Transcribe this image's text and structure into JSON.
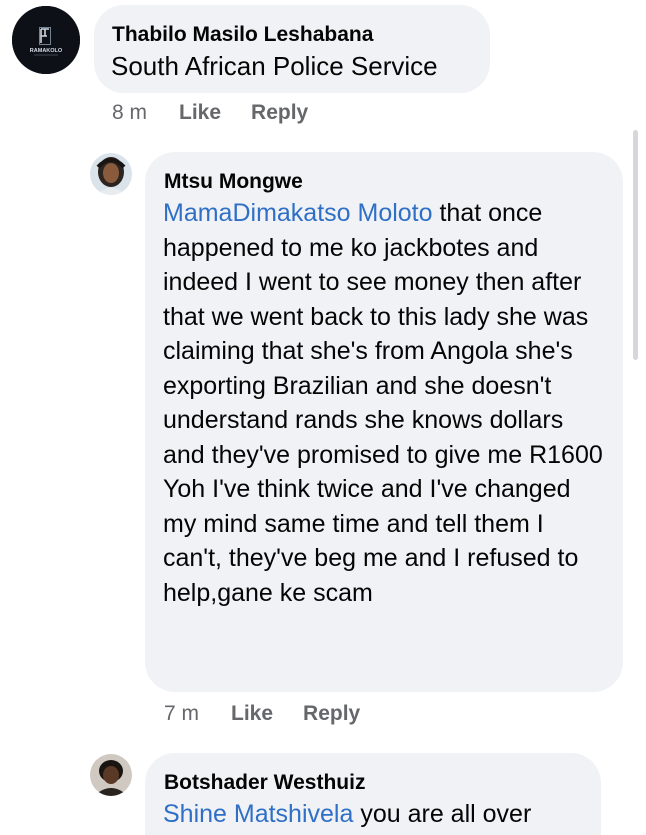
{
  "comments": [
    {
      "author": "Thabilo Masilo Leshabana",
      "avatar_icon": "ramakolo-logo-icon",
      "avatar_brand_text": "RAMAKOLO",
      "mention": "South African Police Service",
      "text": "",
      "time": "8 m",
      "like_label": "Like",
      "reply_label": "Reply"
    },
    {
      "author": "Mtsu Mongwe",
      "avatar_icon": "profile-photo-icon",
      "mention": "MamaDimakatso Moloto",
      "text": "that once happened to me ko jackbotes and indeed I went to see money then after that we went back to this lady she was claiming that she's from Angola she's exporting Brazilian and she doesn't understand rands she knows dollars and they've promised to give me R1600 Yoh I've think twice and I've changed my mind same time and tell them I can't, they've beg me and I refused to help,gane ke scam",
      "time": "7 m",
      "like_label": "Like",
      "reply_label": "Reply"
    },
    {
      "author": "Botshader Westhuiz",
      "avatar_icon": "profile-photo-icon",
      "mention": "Shine Matshivela",
      "text": "you are all over"
    }
  ],
  "colors": {
    "bubble": "#f0f2f5",
    "mention": "#2f6fc6",
    "secondary_text": "#65676b"
  }
}
